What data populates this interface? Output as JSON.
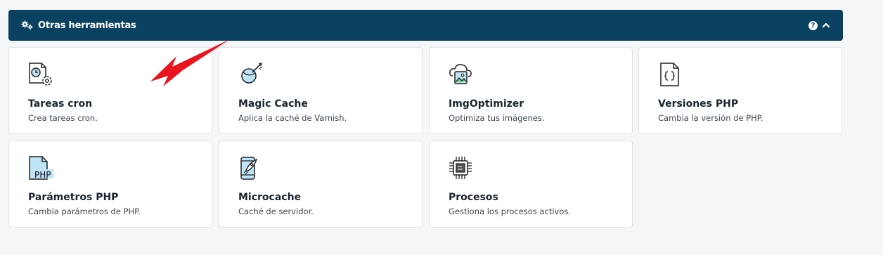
{
  "header": {
    "title": "Otras herramientas",
    "icon": "gears-icon",
    "help_glyph": "?",
    "accent_color": "#0a4060"
  },
  "cards": [
    {
      "title": "Tareas cron",
      "description": "Crea tareas cron.",
      "icon": "cron-gear-icon"
    },
    {
      "title": "Magic Cache",
      "description": "Aplica la caché de Varnish.",
      "icon": "magic-cache-icon"
    },
    {
      "title": "ImgOptimizer",
      "description": "Optimiza tus imágenes.",
      "icon": "cloud-image-icon"
    },
    {
      "title": "Versiones PHP",
      "description": "Cambia la versión de PHP.",
      "icon": "code-file-icon"
    },
    {
      "title": "Parámetros PHP",
      "description": "Cambia parámetros de PHP.",
      "icon": "php-file-icon",
      "icon_text": "PHP"
    },
    {
      "title": "Microcache",
      "description": "Caché de servidor.",
      "icon": "phone-rocket-icon"
    },
    {
      "title": "Procesos",
      "description": "Gestiona los procesos activos.",
      "icon": "cpu-chip-icon"
    }
  ],
  "annotation": {
    "icon": "red-arrow-icon",
    "color": "#e8141e"
  }
}
